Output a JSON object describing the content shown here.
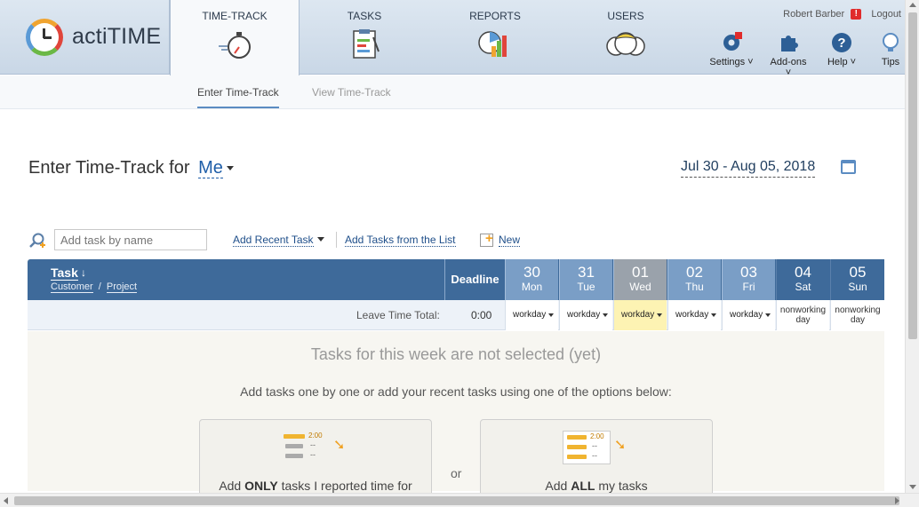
{
  "app": {
    "name": "actiTIME"
  },
  "nav": {
    "tabs": [
      {
        "label": "TIME-TRACK",
        "icon": "stopwatch-icon",
        "active": true
      },
      {
        "label": "TASKS",
        "icon": "task-list-icon"
      },
      {
        "label": "REPORTS",
        "icon": "chart-report-icon"
      },
      {
        "label": "USERS",
        "icon": "users-icon"
      }
    ]
  },
  "header": {
    "user_name": "Robert Barber",
    "alert_mark": "!",
    "logout": "Logout",
    "tools": [
      {
        "label": "Settings",
        "icon": "gear-icon"
      },
      {
        "label": "Add-ons",
        "icon": "puzzle-icon"
      },
      {
        "label": "Help",
        "icon": "help-icon"
      },
      {
        "label": "Tips",
        "icon": "lightbulb-icon"
      }
    ]
  },
  "subnav": {
    "items": [
      "Enter Time-Track",
      "View Time-Track"
    ]
  },
  "page": {
    "title": "Enter Time-Track for",
    "user_selector": "Me",
    "date_range": "Jul 30 - Aug 05, 2018"
  },
  "controls": {
    "search_placeholder": "Add task by name",
    "add_recent": "Add Recent Task",
    "add_from_list": "Add Tasks from the List",
    "new": "New"
  },
  "grid": {
    "task_header": "Task",
    "sort_arrow": "↓",
    "customer": "Customer",
    "slash": "/",
    "project": "Project",
    "deadline": "Deadline",
    "days": [
      {
        "num": "30",
        "name": "Mon",
        "type": "workday"
      },
      {
        "num": "31",
        "name": "Tue",
        "type": "workday"
      },
      {
        "num": "01",
        "name": "Wed",
        "type": "workday",
        "today": true
      },
      {
        "num": "02",
        "name": "Thu",
        "type": "workday"
      },
      {
        "num": "03",
        "name": "Fri",
        "type": "workday"
      },
      {
        "num": "04",
        "name": "Sat",
        "type": "nonworking"
      },
      {
        "num": "05",
        "name": "Sun",
        "type": "nonworking"
      }
    ],
    "leave_label": "Leave Time Total:",
    "leave_total": "0:00",
    "workday_label": "workday",
    "nonworking_line1": "nonworking",
    "nonworking_line2": "day"
  },
  "empty_state": {
    "title": "Tasks for this week are not selected (yet)",
    "subtitle": "Add tasks one by one or add your recent tasks using one of the options below:",
    "or": "or",
    "mini_time": "2:00",
    "mini_dash": "--",
    "option1_pre": "Add ",
    "option1_bold": "ONLY",
    "option1_post": " tasks I reported time for",
    "option2_pre": "Add ",
    "option2_bold": "ALL",
    "option2_post": " my tasks"
  },
  "colors": {
    "header_blue": "#3e6a9a",
    "day_blue": "#7a9ec6",
    "today_highlight": "#fdf3b3",
    "link": "#1f4f8a",
    "alert_red": "#e02b2b"
  }
}
